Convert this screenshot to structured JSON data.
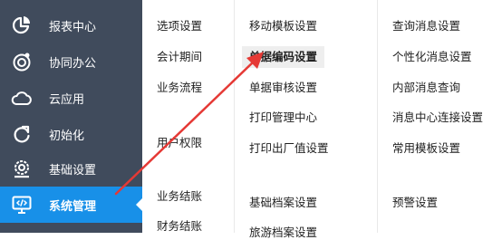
{
  "sidebar": {
    "items": [
      {
        "label": "报表中心",
        "icon": "pie-chart-icon"
      },
      {
        "label": "协同办公",
        "icon": "target-icon"
      },
      {
        "label": "云应用",
        "icon": "cloud-icon"
      },
      {
        "label": "初始化",
        "icon": "refresh-icon"
      },
      {
        "label": "基础设置",
        "icon": "settings-cog-icon"
      },
      {
        "label": "系统管理",
        "icon": "code-monitor-icon"
      }
    ],
    "active_index": 5
  },
  "menu": {
    "col1": {
      "items": [
        "选项设置",
        "会计期间",
        "业务流程",
        "用户权限",
        "业务结账",
        "财务结账"
      ]
    },
    "col2": {
      "items": [
        "移动模板设置",
        "单据编码设置",
        "单据审核设置",
        "打印管理中心",
        "打印出厂值设置",
        "基础档案设置",
        "旅游档案设置"
      ]
    },
    "col3": {
      "items": [
        "查询消息设置",
        "个性化消息设置",
        "内部消息查询",
        "消息中心连接设置",
        "常用模板设置",
        "预警设置"
      ]
    },
    "highlighted": "单据编码设置"
  },
  "colors": {
    "sidebar_bg": "#404b5c",
    "active_bg": "#1890e8",
    "annotation_arrow": "#e53935"
  }
}
